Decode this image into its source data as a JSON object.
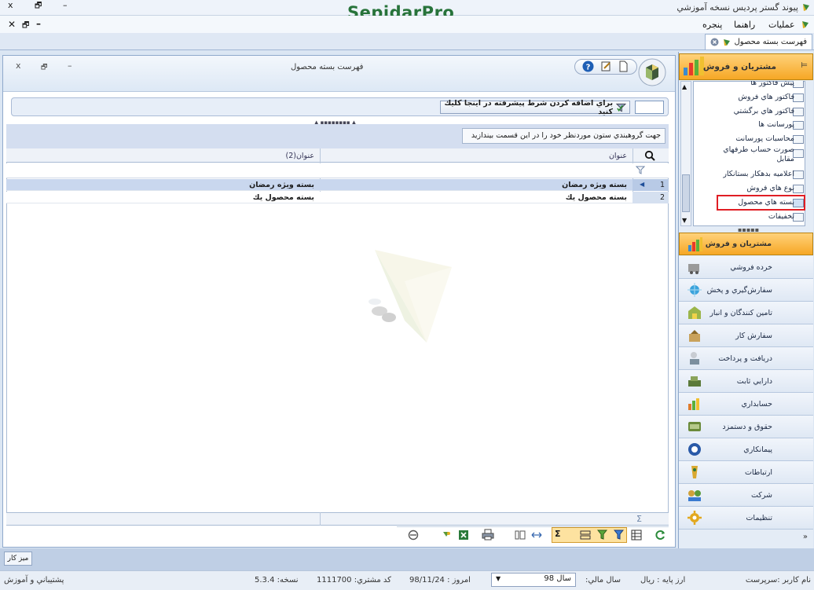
{
  "app": {
    "title": "پیوند گستر پردیس نسخه آموزشي",
    "logo_main": "Sepidar",
    "logo_suffix": "Pro",
    "window_controls": {
      "close": "x",
      "restore": "🗗",
      "minimize": "–"
    },
    "mdi_controls": {
      "close": "✕",
      "restore": "🗗",
      "minimize": "–"
    }
  },
  "menu": {
    "items": [
      "عمليات",
      "راهنما",
      "پنجره"
    ]
  },
  "doc_tab": {
    "label": "فهرست بسته محصول"
  },
  "inner_window": {
    "title": "فهرست بسته محصول",
    "controls": {
      "close": "x",
      "restore": "🗗",
      "minimize": "–"
    }
  },
  "filter": {
    "button_label": "براي اضافه كردن شرط پيشرفته در اينجا كليك كنيد"
  },
  "grid": {
    "group_hint": "جهت گروهبندي ستون موردنظر خود را در اين قسمت بيندازيد",
    "columns": [
      "عنوان",
      "عنوان(2)"
    ],
    "rows": [
      {
        "num": "1",
        "title": "بسته ويژه رمضان",
        "title2": "بسته ويژه رمضان",
        "selected": true
      },
      {
        "num": "2",
        "title": "بسته محصول يك",
        "title2": "بسته محصول يك",
        "selected": false
      }
    ],
    "summary_symbol": "Σ"
  },
  "right_panel": {
    "header": "مشتريان و فروش",
    "pin": "⊨",
    "tree_items": [
      "پيش فاكتور ها",
      "فاكتور هاي فروش",
      "فاكتور هاي برگشتي",
      "پورسانت ها",
      "محاسبات پورسانت",
      "صورت حساب طرفهاي مقابل",
      "اعلاميه بدهكار بستانكار",
      "نوع هاي فروش",
      "بسته هاي محصول",
      "تخفيفات"
    ],
    "nav": [
      {
        "label": "مشتريان و فروش",
        "icon": "sales-icon",
        "color": "#e8a72a"
      },
      {
        "label": "خرده فروشي",
        "icon": "retail-icon",
        "color": "#8a8a8a"
      },
      {
        "label": "سفارش‌گيري و پخش",
        "icon": "distribution-icon",
        "color": "#3aa3dc"
      },
      {
        "label": "تامين كنندگان و انبار",
        "icon": "warehouse-icon",
        "color": "#9bb54a"
      },
      {
        "label": "سفارش كار",
        "icon": "work-order-icon",
        "color": "#c9a25b"
      },
      {
        "label": "دريافت و پرداخت",
        "icon": "payment-icon",
        "color": "#7c8f9e"
      },
      {
        "label": "دارايي ثابت",
        "icon": "fixed-asset-icon",
        "color": "#5b7a3a"
      },
      {
        "label": "حسابداري",
        "icon": "accounting-icon",
        "color": "#e07b2b"
      },
      {
        "label": "حقوق و دستمزد",
        "icon": "payroll-icon",
        "color": "#6a8a3a"
      },
      {
        "label": "پيمانكاري",
        "icon": "contracting-icon",
        "color": "#2a5aa8"
      },
      {
        "label": "ارتباطات",
        "icon": "communication-icon",
        "color": "#d9a830"
      },
      {
        "label": "شركت",
        "icon": "company-icon",
        "color": "#cfa13a"
      },
      {
        "label": "تنظيمات",
        "icon": "settings-icon",
        "color": "#e2a81f"
      }
    ],
    "expand": "»"
  },
  "taskbar": {
    "desk_button": "ميز كار"
  },
  "status": {
    "username": "نام كاربر :سرپرست",
    "base_currency": "ارز پايه :  ريال",
    "fiscal_year_label": "سال مالي:",
    "fiscal_year_value": "سال 98",
    "today": "امروز :   98/11/24",
    "customer_code": "كد مشتري:   1111700",
    "version": "نسخه:   5.3.4",
    "support": "پشتيباني و آموزش"
  }
}
